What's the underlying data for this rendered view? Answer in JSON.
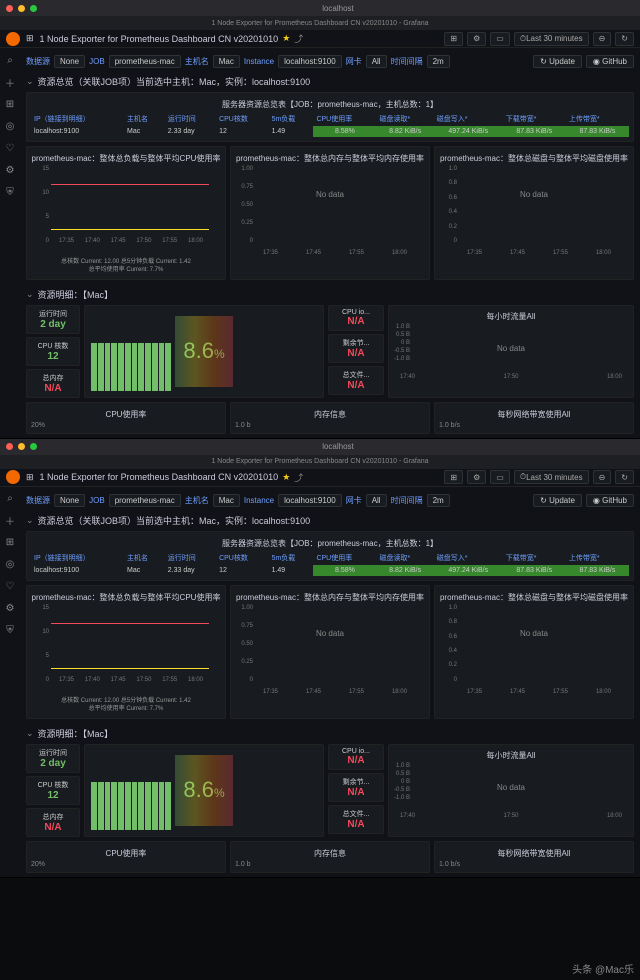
{
  "browser": {
    "title": "localhost",
    "tab": "1 Node Exporter for Prometheus Dashboard CN v20201010 - Grafana"
  },
  "header": {
    "title": "1 Node Exporter for Prometheus Dashboard CN v20201010",
    "btns": {
      "add": "",
      "cycle": "",
      "time": "Last 30 minutes",
      "refresh": ""
    }
  },
  "vars": {
    "l1": "数据源",
    "v1": "None",
    "l2": "JOB",
    "v2": "prometheus-mac",
    "l3": "主机名",
    "v3": "Mac",
    "l4": "Instance",
    "v4": "localhost:9100",
    "l5": "网卡",
    "v5": "All",
    "l6": "时间间隔",
    "v6": "2m",
    "upd": "Update",
    "gh": "GitHub"
  },
  "section1": {
    "title": "资源总览（关联JOB项）当前选中主机：Mac，实例：localhost:9100"
  },
  "overview": {
    "title": "服务器资源总览表【JOB：prometheus-mac，主机总数：1】",
    "cols": {
      "c1": "IP（链接到明细）",
      "c2": "主机名",
      "c3": "运行时间",
      "c4": "CPU核数",
      "c5": "5m负载",
      "c6": "CPU使用率",
      "c7": "磁盘读取*",
      "c8": "磁盘写入*",
      "c9": "下载带宽*",
      "c10": "上传带宽*"
    },
    "row": {
      "ip": "localhost:9100",
      "host": "Mac",
      "uptime": "2.33 day",
      "cores": "12",
      "load": "1.49",
      "cpu": "8.58%",
      "dr": "8.82 KiB/s",
      "dw": "497.24 KiB/s",
      "down": "87.83 KiB/s",
      "up": "87.83 KiB/s"
    }
  },
  "mini": {
    "p1": "prometheus-mac：整体总负载与整体平均CPU使用率",
    "p2": "prometheus-mac：整体总内存与整体平均内存使用率",
    "p3": "prometheus-mac：整体总磁盘与整体平均磁盘使用率",
    "nodata": "No data",
    "leg1": "总核数  Current: 12.00    总5分钟负载  Current: 1.42",
    "leg2": "总平均使用率  Current: 7.7%",
    "times": [
      "17:35",
      "17:40",
      "17:45",
      "17:50",
      "17:55",
      "18:00"
    ]
  },
  "chart_data": {
    "type": "line",
    "title": "整体总负载与整体平均CPU使用率",
    "x": [
      "17:35",
      "17:40",
      "17:45",
      "17:50",
      "17:55",
      "18:00"
    ],
    "series": [
      {
        "name": "总核数",
        "values": [
          12,
          12,
          12,
          12,
          12,
          12
        ],
        "color": "#f2495c"
      },
      {
        "name": "总5分钟负载",
        "values": [
          1.4,
          1.4,
          1.4,
          1.4,
          1.4,
          1.42
        ],
        "color": "#fade2a"
      },
      {
        "name": "总平均使用率",
        "values": [
          8,
          8,
          8,
          7.8,
          7.7,
          7.7
        ],
        "unit": "%"
      }
    ],
    "ylim_left": [
      0,
      15
    ],
    "ylim_right": [
      0,
      20
    ],
    "right_unit": "%"
  },
  "section2": {
    "title": "资源明细：【Mac】"
  },
  "stats": {
    "s1l": "运行时间",
    "s1v": "2 day",
    "s2l": "CPU 核数",
    "s2v": "12",
    "s3l": "总内存",
    "s3v": "N/A",
    "gauge": "8.6",
    "gaugeu": "%",
    "m1l": "CPU io...",
    "m1v": "N/A",
    "m2l": "剩余节...",
    "m2v": "N/A",
    "m3l": "总文件...",
    "m3v": "N/A",
    "traf": "每小时流量All",
    "trafnd": "No data",
    "trafy": [
      "1.0 B",
      "0.5 B",
      "0 B",
      "-0.5 B",
      "-1.0 B"
    ]
  },
  "bottom": {
    "p1": "CPU使用率",
    "p2": "内存信息",
    "p3": "每秒网络带宽使用All",
    "v1": "20%",
    "v2": "1.0 b",
    "v3": "1.0 b/s"
  },
  "watermark": "头条 @Mac乐"
}
